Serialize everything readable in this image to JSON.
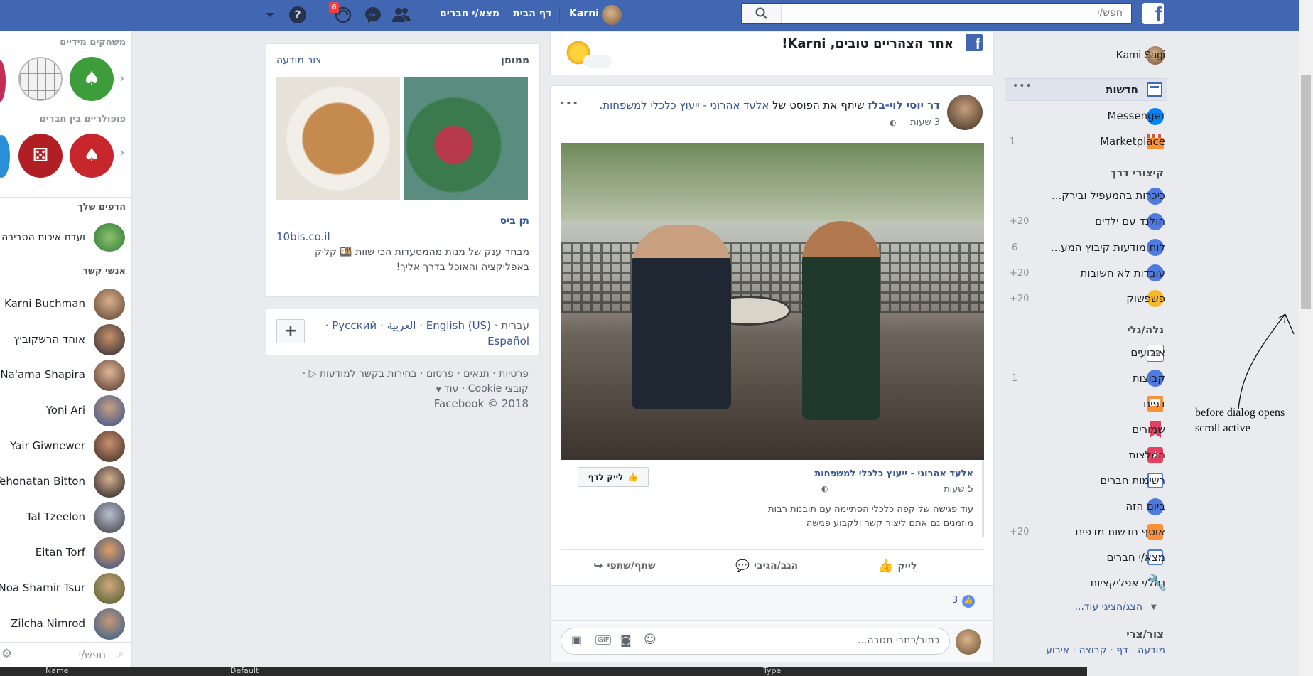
{
  "topbar": {
    "user_name": "Karni",
    "home": "דף הבית",
    "find_friends": "מצא/י חברים",
    "notif_count": "6",
    "search_placeholder": "חפש/י"
  },
  "left_nav": {
    "user": "Karni Sagi",
    "items": [
      {
        "label": "חדשות"
      },
      {
        "label": "Messenger"
      },
      {
        "label": "Marketplace",
        "count": "1"
      }
    ],
    "shortcuts_title": "קיצורי דרך",
    "shortcuts": [
      {
        "label": "כיכרות בהמעפיל ובירק...",
        "count": ""
      },
      {
        "label": "הולנד עם ילדים",
        "count": "+20"
      },
      {
        "label": "לוח מודעות קיבוץ המע...",
        "count": "6"
      },
      {
        "label": "עובדות לא חשובות",
        "count": "+20"
      },
      {
        "label": "פשפשוק",
        "count": "+20"
      }
    ],
    "explore_title": "גלה/גלי",
    "explore": [
      {
        "label": "אירועים",
        "count": "",
        "icon_text": "22"
      },
      {
        "label": "קבוצות",
        "count": "1"
      },
      {
        "label": "דפים",
        "count": ""
      },
      {
        "label": "שמורים",
        "count": ""
      },
      {
        "label": "המלצות",
        "count": ""
      },
      {
        "label": "רשימות חברים",
        "count": ""
      },
      {
        "label": "ביום הזה",
        "count": ""
      },
      {
        "label": "אוסף חדשות מדפים",
        "count": "+20"
      },
      {
        "label": "מצא/י חברים",
        "count": ""
      },
      {
        "label": "נהל/י אפליקציות",
        "count": ""
      }
    ],
    "see_more": "הצג/הציגי עוד...",
    "create_title": "צור/צרי",
    "create_links": [
      "מודעה",
      "דף",
      "קבוצה",
      "אירוע"
    ]
  },
  "greeting": {
    "text": "אחר הצהריים טובים, Karni!"
  },
  "post": {
    "author": "דר יוסי לוי-בלז",
    "action": " שיתף את הפוסט של ",
    "shared_page": "אלעד אהרוני - ייעוץ כלכלי למשפחות.",
    "time": "3 שעות",
    "more": "•••",
    "inner_author": "אלעד אהרוני - ייעוץ כלכלי למשפחות",
    "inner_time": "5 שעות",
    "like_page": "לייק לדף",
    "text_line1": "עוד פגישה של קפה כלכלי הסתיימה עם תובנות רבות",
    "text_line2": "מוזמנים גם אתם ליצור קשר ולקבוע פגישה",
    "like": "לייק",
    "comment": "הגב/הגיבי",
    "share": "שתף/שתפי",
    "likes_count": "3",
    "comment_placeholder": "כתוב/כתבי תגובה...",
    "gif": "GIF"
  },
  "sponsored": {
    "title": "ממומן",
    "create_ad": "צור מודעה",
    "ad_title": "תן ביס",
    "ad_url": "10bis.co.il",
    "ad_text_1": "מבחר ענק של מנות מהמסעדות הכי שוות",
    "ad_text_2": "קליק",
    "ad_text_3": "באפליקציה והאוכל בדרך אליך!"
  },
  "languages": {
    "current": "עברית",
    "list": [
      "English (US)",
      "العربية",
      "Русский"
    ],
    "extra": "Español",
    "plus": "+"
  },
  "footer": {
    "line1": [
      "פרטיות",
      "תנאים",
      "פרסום",
      "בחירות בקשר למודעות"
    ],
    "line2": [
      "קובצי Cookie",
      "עוד"
    ],
    "copyright": "Facebook © 2018"
  },
  "right_rail": {
    "games_title": "משחקים מידיים",
    "popular_title": "פופולריים בין חברים",
    "pages_title": "הדפים שלך",
    "page_name": "ועדת איכות הסביבה -",
    "contacts_title": "אנשי קשר",
    "contacts": [
      "tal Karni Buchman",
      "אוהד הרשקוביץ",
      "Na'ama Shapira",
      "Yoni Ari",
      "Yair Giwnewer",
      "Yehonatan Bitton",
      "Tal Tzeelon",
      "Eitan Torf",
      "Noa Shamir Tsur",
      "Zilcha Nimrod"
    ],
    "chat_search": "חפש/י"
  },
  "annotation": {
    "line1": "before dialog opens",
    "line2": "scroll active"
  },
  "bottom_strip": [
    "Name",
    "Default",
    "Type"
  ]
}
